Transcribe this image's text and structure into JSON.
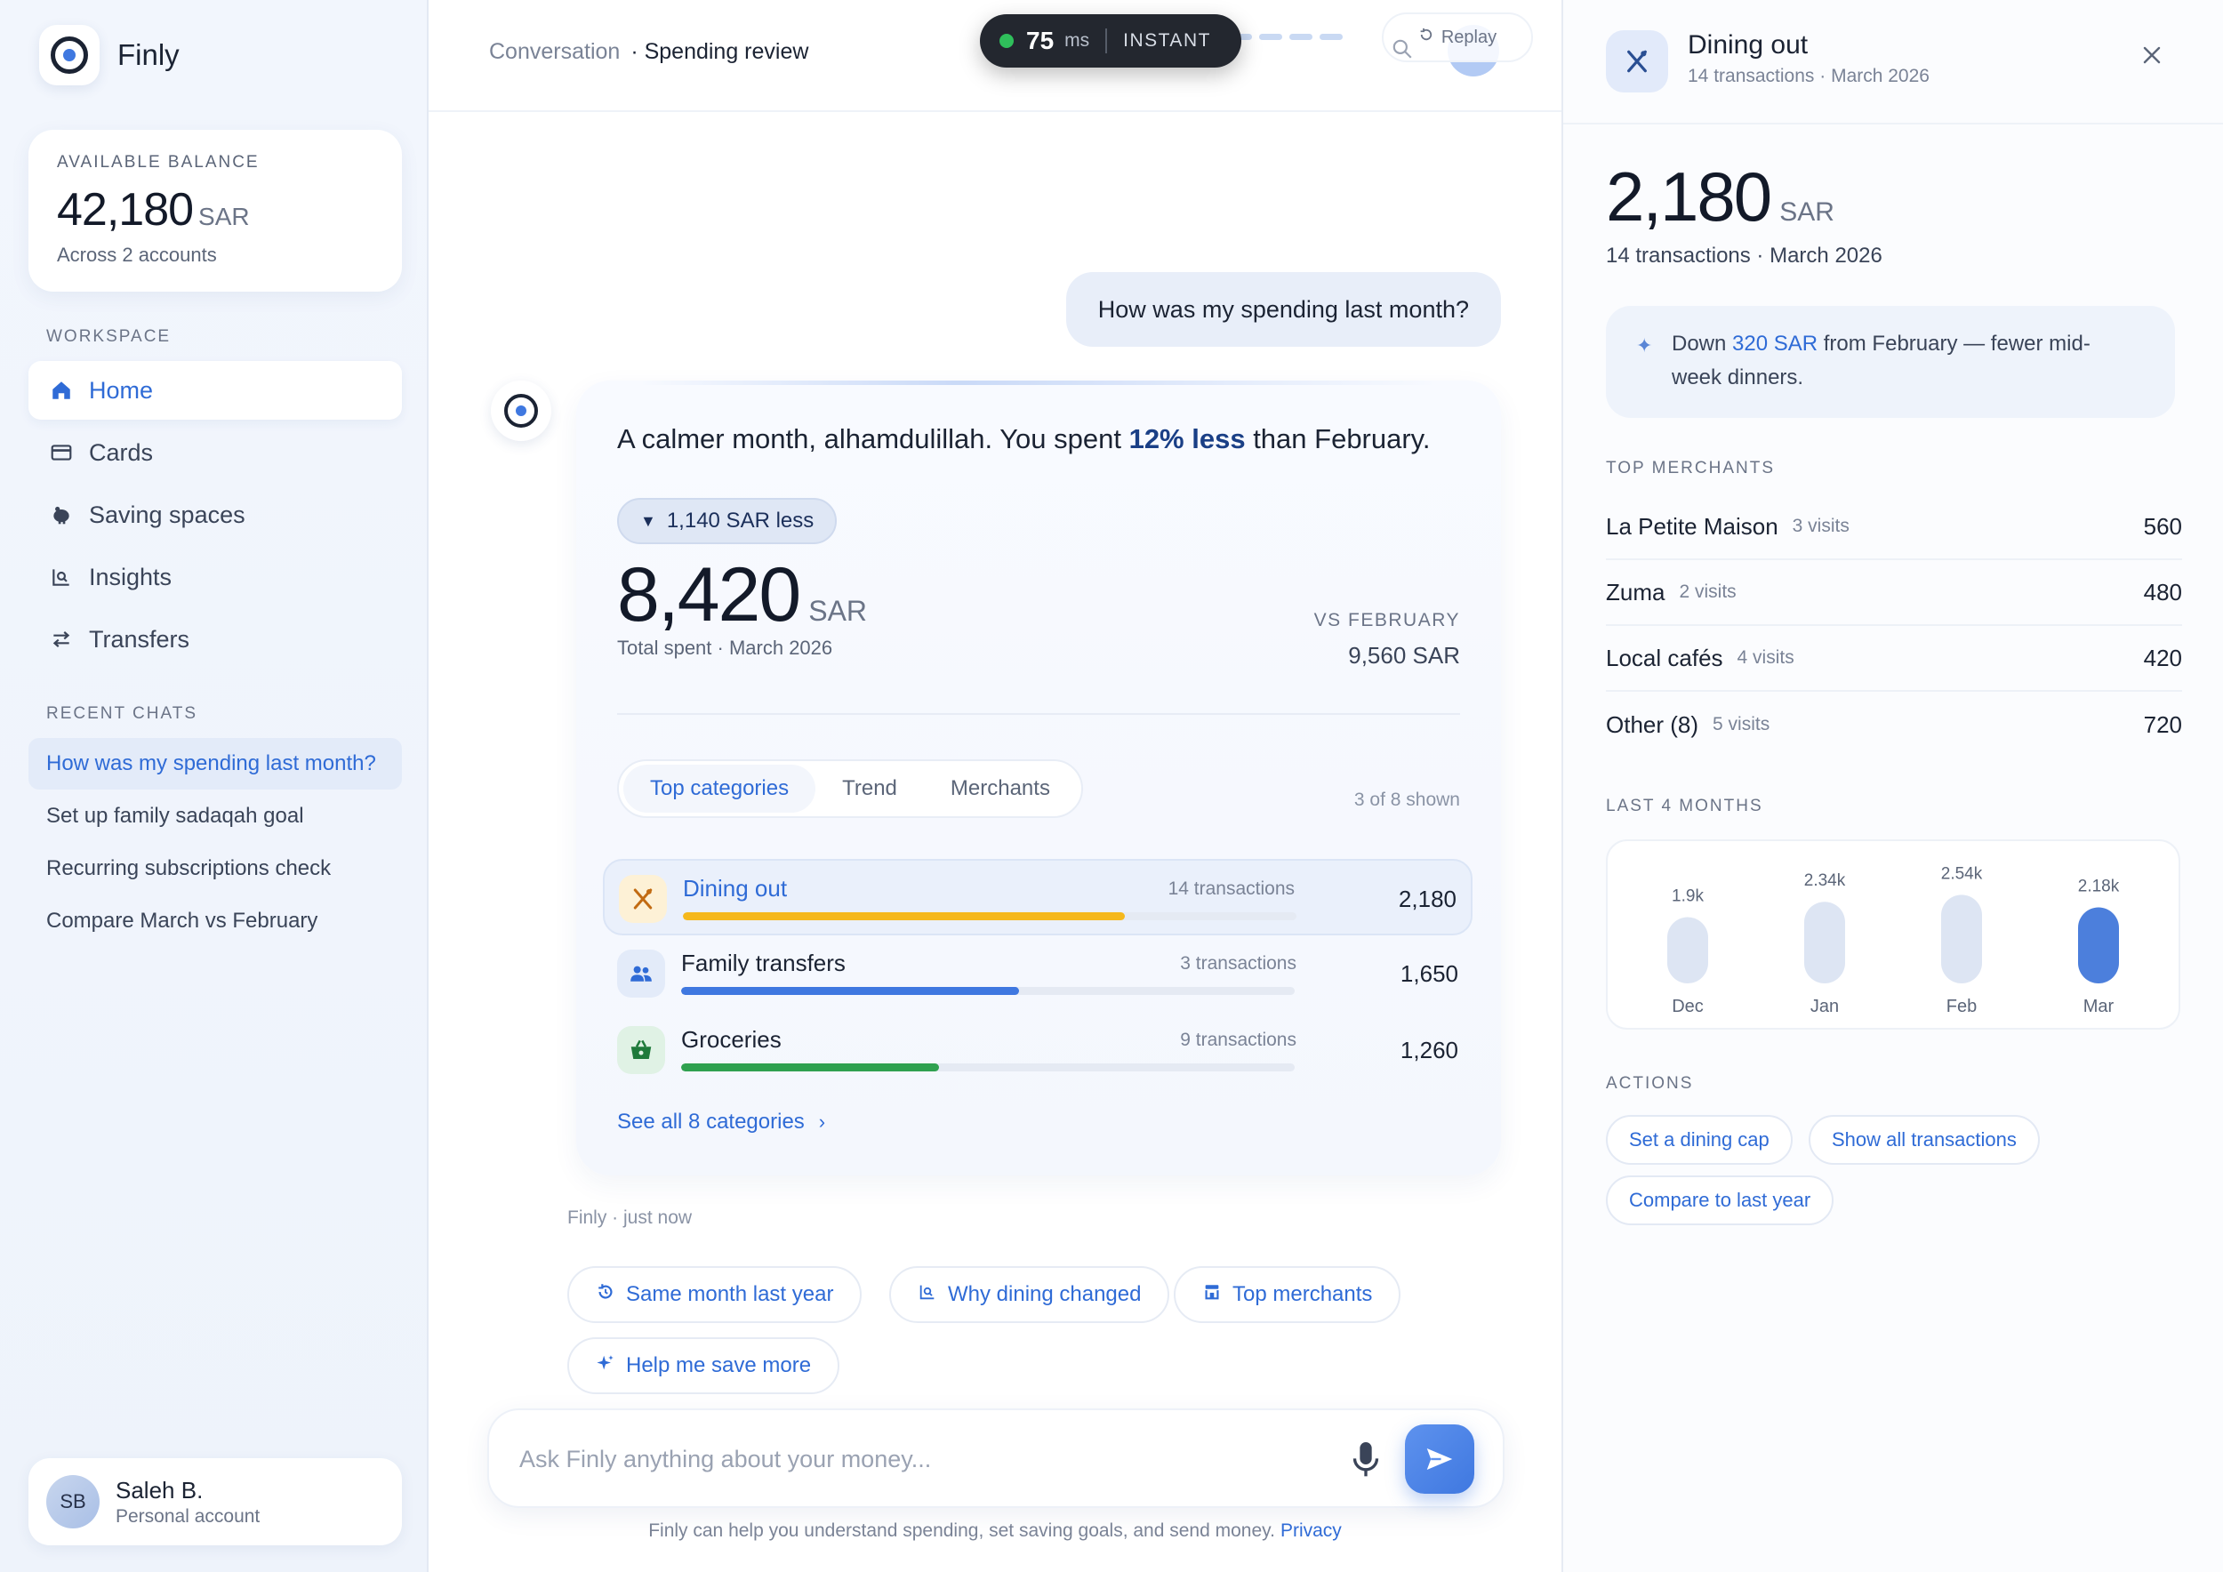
{
  "sidebar": {
    "brand": "Finly",
    "balance": {
      "label": "AVAILABLE BALANCE",
      "amount": "42,180",
      "currency": "SAR",
      "sub": "Across 2 accounts"
    },
    "workspace_label": "WORKSPACE",
    "nav": [
      {
        "label": "Home",
        "icon": "home-icon",
        "active": true
      },
      {
        "label": "Cards",
        "icon": "card-icon"
      },
      {
        "label": "Saving spaces",
        "icon": "piggy-bank-icon"
      },
      {
        "label": "Insights",
        "icon": "insights-icon"
      },
      {
        "label": "Transfers",
        "icon": "transfer-icon"
      }
    ],
    "recent_label": "RECENT CHATS",
    "chats": [
      "How was my spending last month?",
      "Set up family sadaqah goal",
      "Recurring subscriptions check",
      "Compare March vs February"
    ],
    "profile": {
      "initials": "SB",
      "name": "Saleh B.",
      "sub": "Personal account"
    }
  },
  "topbar": {
    "crumb_root": "Conversation",
    "crumb_current": "· Spending review",
    "latency_value": "75",
    "latency_unit": "ms",
    "latency_mode": "INSTANT",
    "replay_label": "Replay"
  },
  "conversation": {
    "user_message": "How was my spending last month?",
    "headline_pre": "A calmer month, alhamdulillah. You spent ",
    "headline_bold": "12% less",
    "headline_post": " than February.",
    "delta_pill": "1,140 SAR less",
    "total": "8,420",
    "currency": "SAR",
    "total_sub": "Total spent · March 2026",
    "vs_label": "VS FEBRUARY",
    "vs_value": "9,560 SAR",
    "tabs": [
      "Top categories",
      "Trend",
      "Merchants"
    ],
    "shown_count": "3 of 8 shown",
    "categories": [
      {
        "name": "Dining out",
        "count": "14 transactions",
        "amount": "2,180",
        "fill": 0.72,
        "color": "#f5b81c",
        "icon": "utensils-icon",
        "icon_bg": "#fdf1d6",
        "active": true
      },
      {
        "name": "Family transfers",
        "count": "3 transactions",
        "amount": "1,650",
        "fill": 0.55,
        "color": "#3f78e0",
        "icon": "family-icon",
        "icon_bg": "#e3ebf9"
      },
      {
        "name": "Groceries",
        "count": "9 transactions",
        "amount": "1,260",
        "fill": 0.42,
        "color": "#2fa14f",
        "icon": "basket-icon",
        "icon_bg": "#e0f2e5"
      }
    ],
    "see_all": "See all 8 categories",
    "meta": "Finly · just now",
    "suggestions": [
      {
        "label": "Same month last year",
        "icon": "history-icon"
      },
      {
        "label": "Why dining changed",
        "icon": "insights-icon"
      },
      {
        "label": "Top merchants",
        "icon": "store-icon"
      },
      {
        "label": "Help me save more",
        "icon": "sparkle-icon"
      }
    ]
  },
  "composer": {
    "placeholder": "Ask Finly anything about your money...",
    "disclaimer": "Finly can help you understand spending, set saving goals, and send money.",
    "privacy_link": "Privacy"
  },
  "panel": {
    "title": "Dining out",
    "subtitle": "14 transactions · March 2026",
    "amount": "2,180",
    "currency": "SAR",
    "amount_sub": "14 transactions · March 2026",
    "insight_pre": "Down ",
    "insight_highlight": "320 SAR",
    "insight_post": " from February — fewer mid-week dinners.",
    "merchants_label": "TOP MERCHANTS",
    "merchants": [
      {
        "name": "La Petite Maison",
        "visits": "3 visits",
        "amount": "560"
      },
      {
        "name": "Zuma",
        "visits": "2 visits",
        "amount": "480"
      },
      {
        "name": "Local cafés",
        "visits": "4 visits",
        "amount": "420"
      },
      {
        "name": "Other (8)",
        "visits": "5 visits",
        "amount": "720"
      }
    ],
    "months_label": "LAST 4 MONTHS",
    "actions_label": "ACTIONS",
    "actions": [
      "Set a dining cap",
      "Show all transactions",
      "Compare to last year"
    ]
  },
  "chart_data": {
    "type": "bar",
    "categories": [
      "Dec",
      "Jan",
      "Feb",
      "Mar"
    ],
    "values": [
      1900,
      2340,
      2540,
      2180
    ],
    "value_labels": [
      "1.9k",
      "2.34k",
      "2.54k",
      "2.18k"
    ],
    "highlight": "Mar",
    "colors": {
      "default": "#dde5f3",
      "highlight": "#4c7fdc"
    }
  }
}
